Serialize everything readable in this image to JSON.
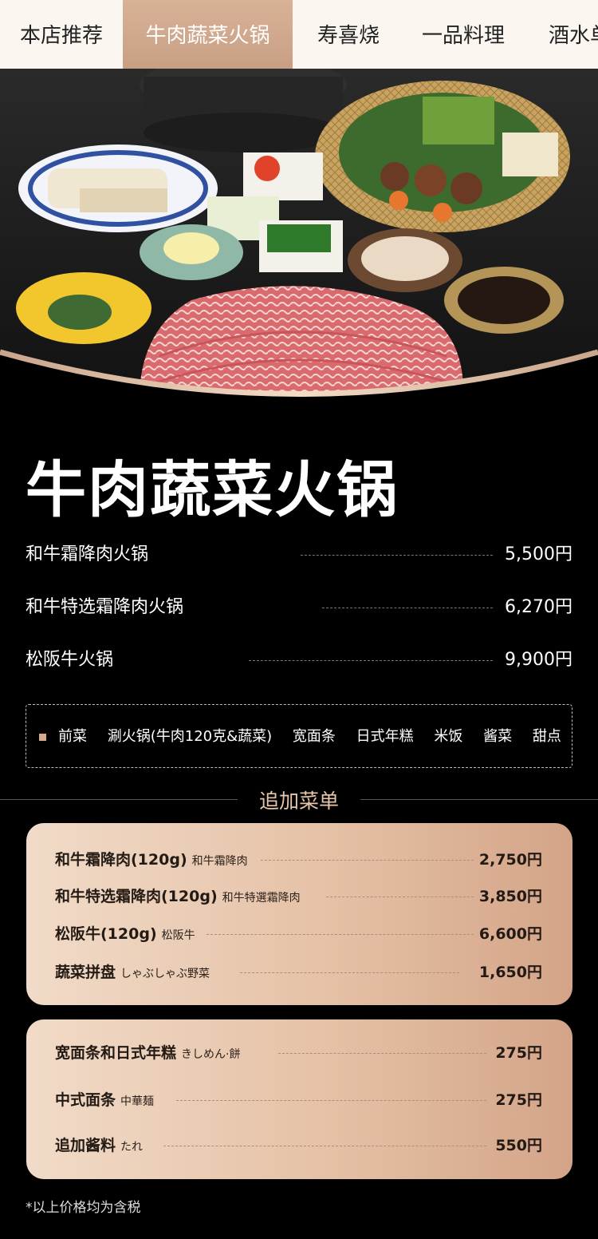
{
  "tabs": [
    {
      "label": "本店推荐",
      "active": false
    },
    {
      "label": "牛肉蔬菜火锅",
      "active": true
    },
    {
      "label": "寿喜烧",
      "active": false
    },
    {
      "label": "一品料理",
      "active": false
    },
    {
      "label": "酒水单",
      "active": false
    }
  ],
  "hero": {
    "image_icon": "hotpot-meal-photo"
  },
  "page_title": "牛肉蔬菜火锅",
  "menu": [
    {
      "name": "和牛霜降肉火锅",
      "price": "5,500円"
    },
    {
      "name": "和牛特选霜降肉火锅",
      "price": "6,270円"
    },
    {
      "name": "松阪牛火锅",
      "price": "9,900円"
    }
  ],
  "set_contents": [
    "前菜",
    "涮火锅(牛肉120克&蔬菜)",
    "宽面条",
    "日式年糕",
    "米饭",
    "酱菜",
    "甜点"
  ],
  "add_menu": {
    "heading": "追加菜单",
    "card1": [
      {
        "name": "和牛霜降肉(120g)",
        "jp": "和牛霜降肉",
        "price": "2,750円"
      },
      {
        "name": "和牛特选霜降肉(120g)",
        "jp": "和牛特選霜降肉",
        "price": "3,850円"
      },
      {
        "name": "松阪牛(120g)",
        "jp": "松阪牛",
        "price": "6,600円"
      },
      {
        "name": "蔬菜拼盘",
        "jp": "しゃぶしゃぶ野菜",
        "price": "1,650円"
      }
    ],
    "card2": [
      {
        "name": "宽面条和日式年糕",
        "jp": "きしめん·餅",
        "price": "275円"
      },
      {
        "name": "中式面条",
        "jp": "中華麺",
        "price": "275円"
      },
      {
        "name": "追加酱料",
        "jp": "たれ",
        "price": "550円"
      }
    ]
  },
  "footnote": "*以上价格均为含税",
  "colors": {
    "accent": "#d9ab8d",
    "tab_active": "#c89f84",
    "card_gradient_start": "#f1dbc8",
    "card_gradient_end": "#d4a488"
  }
}
